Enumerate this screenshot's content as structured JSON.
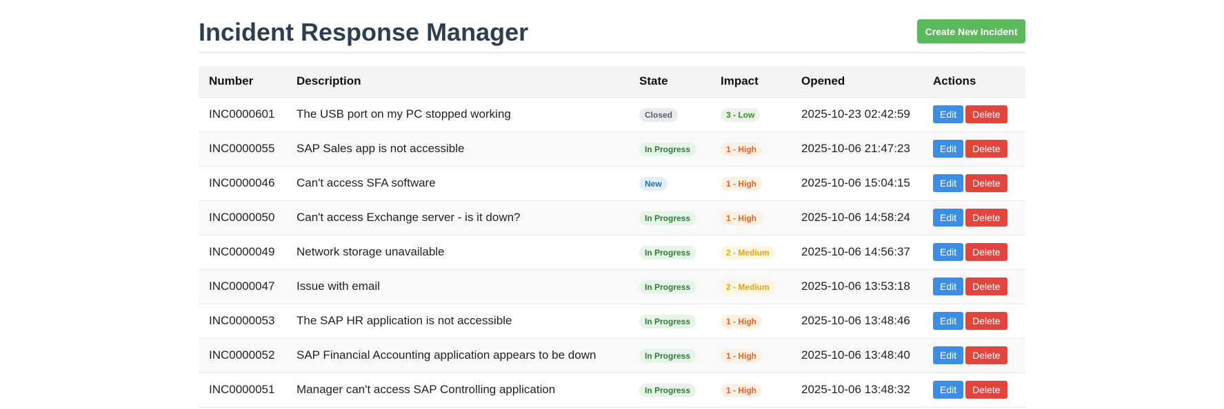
{
  "header": {
    "title": "Incident Response Manager",
    "create_label": "Create New Incident"
  },
  "table": {
    "columns": [
      "Number",
      "Description",
      "State",
      "Impact",
      "Opened",
      "Actions"
    ],
    "rows": [
      {
        "number": "INC0000601",
        "description": "The USB port on my PC stopped working",
        "state": "Closed",
        "state_kind": "closed",
        "impact": "3 - Low",
        "impact_kind": "low",
        "opened": "2025-10-23 02:42:59"
      },
      {
        "number": "INC0000055",
        "description": "SAP Sales app is not accessible",
        "state": "In Progress",
        "state_kind": "progress",
        "impact": "1 - High",
        "impact_kind": "high",
        "opened": "2025-10-06 21:47:23"
      },
      {
        "number": "INC0000046",
        "description": "Can't access SFA software",
        "state": "New",
        "state_kind": "new",
        "impact": "1 - High",
        "impact_kind": "high",
        "opened": "2025-10-06 15:04:15"
      },
      {
        "number": "INC0000050",
        "description": "Can't access Exchange server - is it down?",
        "state": "In Progress",
        "state_kind": "progress",
        "impact": "1 - High",
        "impact_kind": "high",
        "opened": "2025-10-06 14:58:24"
      },
      {
        "number": "INC0000049",
        "description": "Network storage unavailable",
        "state": "In Progress",
        "state_kind": "progress",
        "impact": "2 - Medium",
        "impact_kind": "medium",
        "opened": "2025-10-06 14:56:37"
      },
      {
        "number": "INC0000047",
        "description": "Issue with email",
        "state": "In Progress",
        "state_kind": "progress",
        "impact": "2 - Medium",
        "impact_kind": "medium",
        "opened": "2025-10-06 13:53:18"
      },
      {
        "number": "INC0000053",
        "description": "The SAP HR application is not accessible",
        "state": "In Progress",
        "state_kind": "progress",
        "impact": "1 - High",
        "impact_kind": "high",
        "opened": "2025-10-06 13:48:46"
      },
      {
        "number": "INC0000052",
        "description": "SAP Financial Accounting application appears to be down",
        "state": "In Progress",
        "state_kind": "progress",
        "impact": "1 - High",
        "impact_kind": "high",
        "opened": "2025-10-06 13:48:40"
      },
      {
        "number": "INC0000051",
        "description": "Manager can't access SAP Controlling application",
        "state": "In Progress",
        "state_kind": "progress",
        "impact": "1 - High",
        "impact_kind": "high",
        "opened": "2025-10-06 13:48:32"
      }
    ],
    "edit_label": "Edit",
    "delete_label": "Delete"
  },
  "colors": {
    "title": "#2c3e50",
    "create_button": "#5cb85c",
    "edit_button": "#3b8ee3",
    "delete_button": "#e0463e"
  }
}
